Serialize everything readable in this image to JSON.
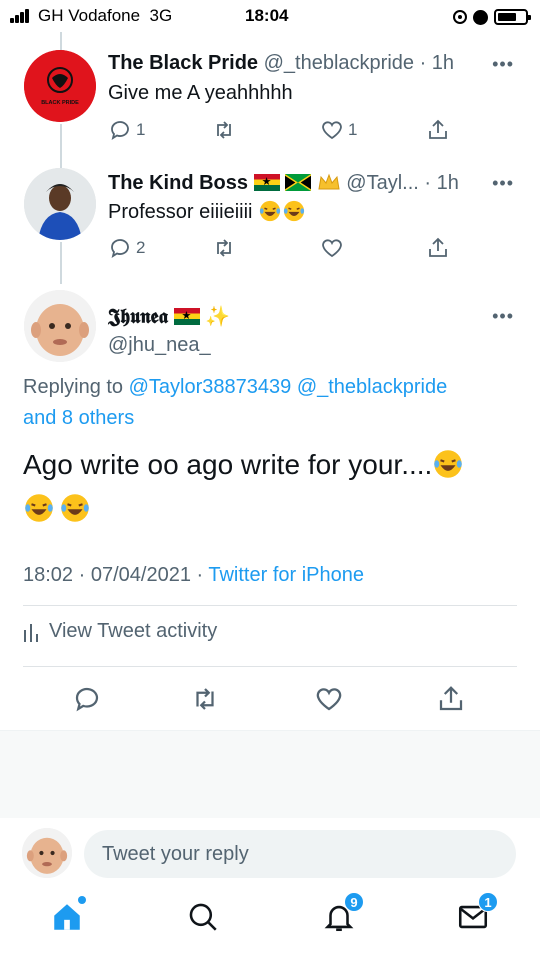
{
  "status_bar": {
    "carrier": "GH Vodafone",
    "network": "3G",
    "time": "18:04"
  },
  "thread": [
    {
      "display_name": "The Black Pride",
      "handle": "@_theblackpride",
      "age": "· 1h",
      "text": "Give me A yeahhhhh",
      "avatar_text": "BLACK PRIDE",
      "reply_count": "1",
      "retweet_count": "",
      "like_count": "1"
    },
    {
      "display_name": "The Kind Boss",
      "handle": "@Tayl...",
      "age": "· 1h",
      "text": "Professor eiiieiiii",
      "reply_count": "2",
      "retweet_count": "",
      "like_count": ""
    }
  ],
  "focused_tweet": {
    "display_name": "𝕵𝖍𝖚𝖓𝖊𝖆",
    "handle": "@jhu_nea_",
    "replying_prefix": "Replying to",
    "mentions": "@Taylor38873439 @_theblackpride",
    "and_others": "and 8 others",
    "text": "Ago write oo ago write for your....",
    "time": "18:02",
    "date": "· 07/04/2021 ·",
    "source": "Twitter for iPhone",
    "view_activity": "View Tweet activity"
  },
  "composer": {
    "placeholder": "Tweet your reply"
  },
  "tabbar": {
    "notifications_badge": "9",
    "messages_badge": "1"
  },
  "colors": {
    "accent": "#1d9bf0",
    "muted": "#536471",
    "text": "#0f1419"
  },
  "icons": [
    "signal-icon",
    "orientation-lock-icon",
    "alarm-icon",
    "battery-icon",
    "more-icon",
    "reply-icon",
    "retweet-icon",
    "like-icon",
    "share-icon",
    "analytics-icon",
    "home-icon",
    "search-icon",
    "notifications-icon",
    "messages-icon"
  ]
}
